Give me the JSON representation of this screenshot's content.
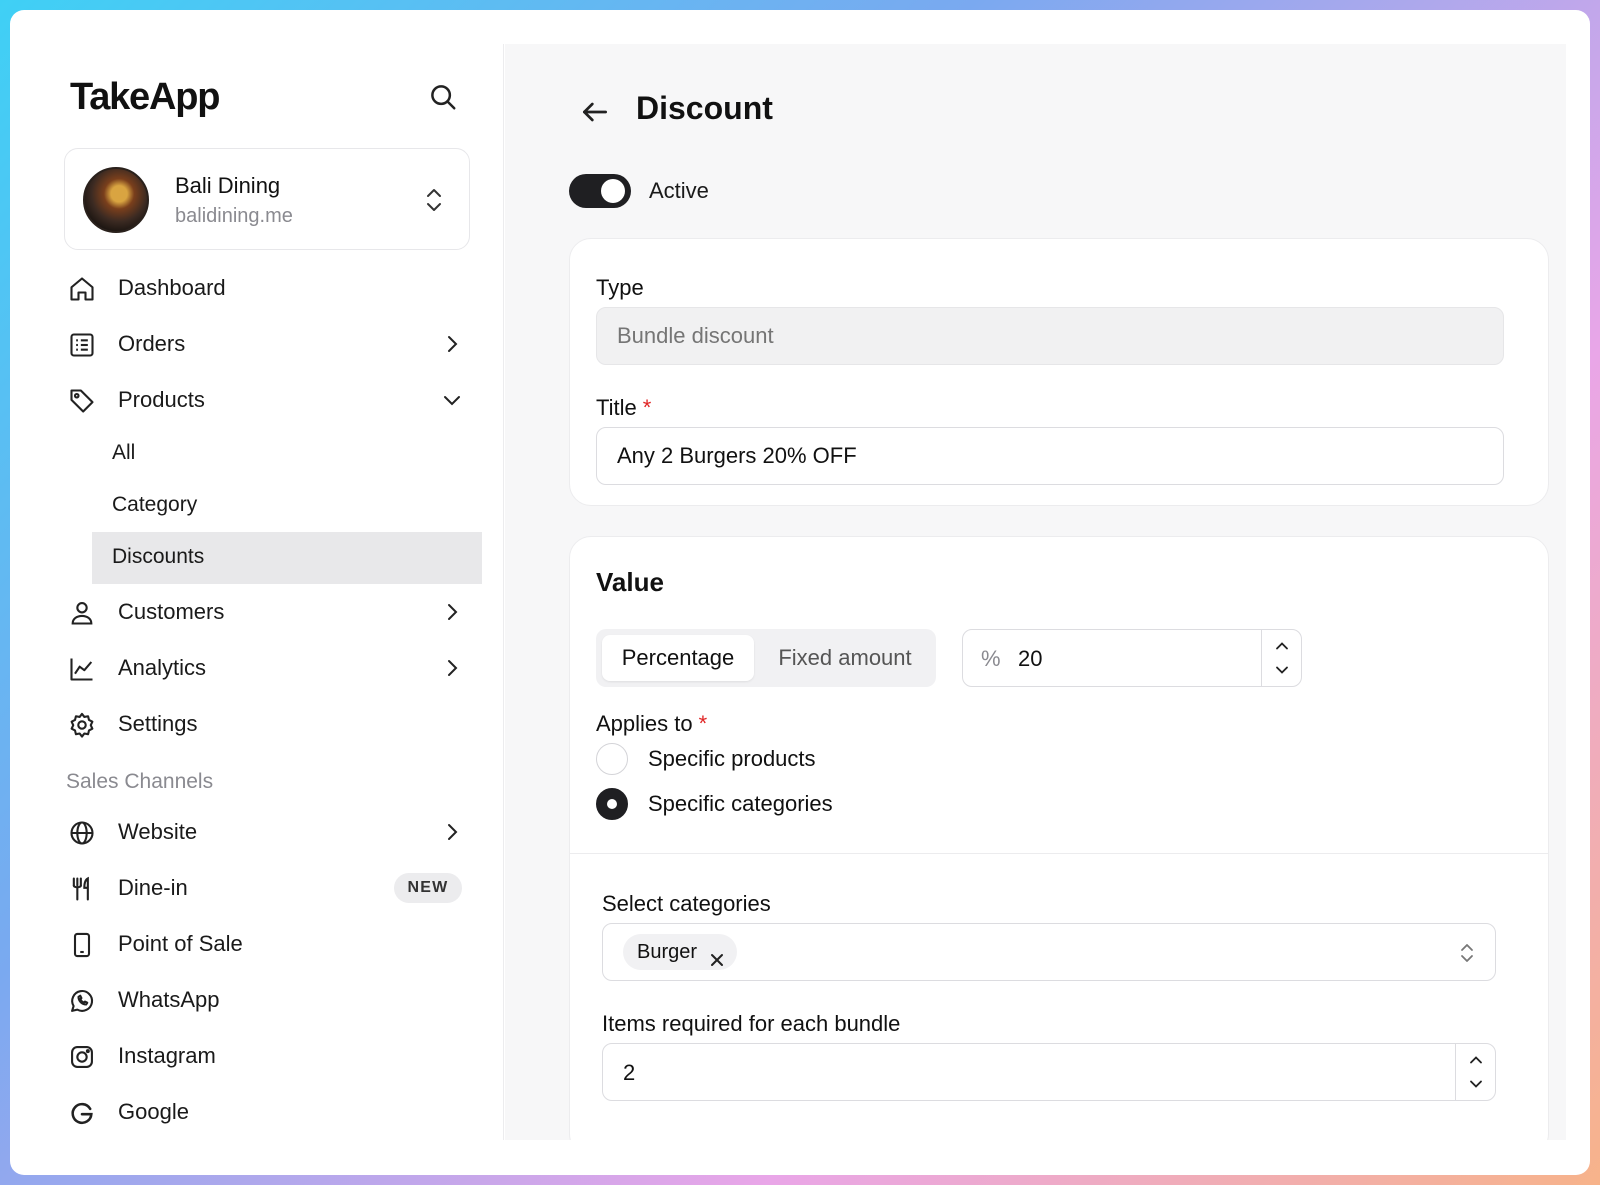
{
  "app": {
    "logo": "TakeApp"
  },
  "store": {
    "name": "Bali Dining",
    "url": "balidining.me"
  },
  "sidebar": {
    "items": [
      {
        "label": "Dashboard"
      },
      {
        "label": "Orders"
      },
      {
        "label": "Products"
      },
      {
        "label": "Customers"
      },
      {
        "label": "Analytics"
      },
      {
        "label": "Settings"
      }
    ],
    "products_sub": [
      {
        "label": "All"
      },
      {
        "label": "Category"
      },
      {
        "label": "Discounts"
      }
    ],
    "sales_channels_label": "Sales Channels",
    "channels": [
      {
        "label": "Website"
      },
      {
        "label": "Dine-in",
        "badge": "NEW"
      },
      {
        "label": "Point of Sale"
      },
      {
        "label": "WhatsApp"
      },
      {
        "label": "Instagram"
      },
      {
        "label": "Google"
      }
    ]
  },
  "page": {
    "title": "Discount",
    "active_label": "Active",
    "active": true
  },
  "form": {
    "type_label": "Type",
    "type_placeholder": "Bundle discount",
    "title_label": "Title",
    "title_value": "Any 2 Burgers 20% OFF",
    "required_mark": "*",
    "value_heading": "Value",
    "value_tabs": [
      {
        "label": "Percentage",
        "selected": true
      },
      {
        "label": "Fixed amount",
        "selected": false
      }
    ],
    "value_prefix": "%",
    "value_amount": "20",
    "applies_to_label": "Applies to",
    "applies_options": [
      {
        "label": "Specific products",
        "checked": false
      },
      {
        "label": "Specific categories",
        "checked": true
      }
    ],
    "select_categories_label": "Select categories",
    "selected_categories": [
      "Burger"
    ],
    "items_required_label": "Items required for each bundle",
    "items_required_value": "2"
  }
}
